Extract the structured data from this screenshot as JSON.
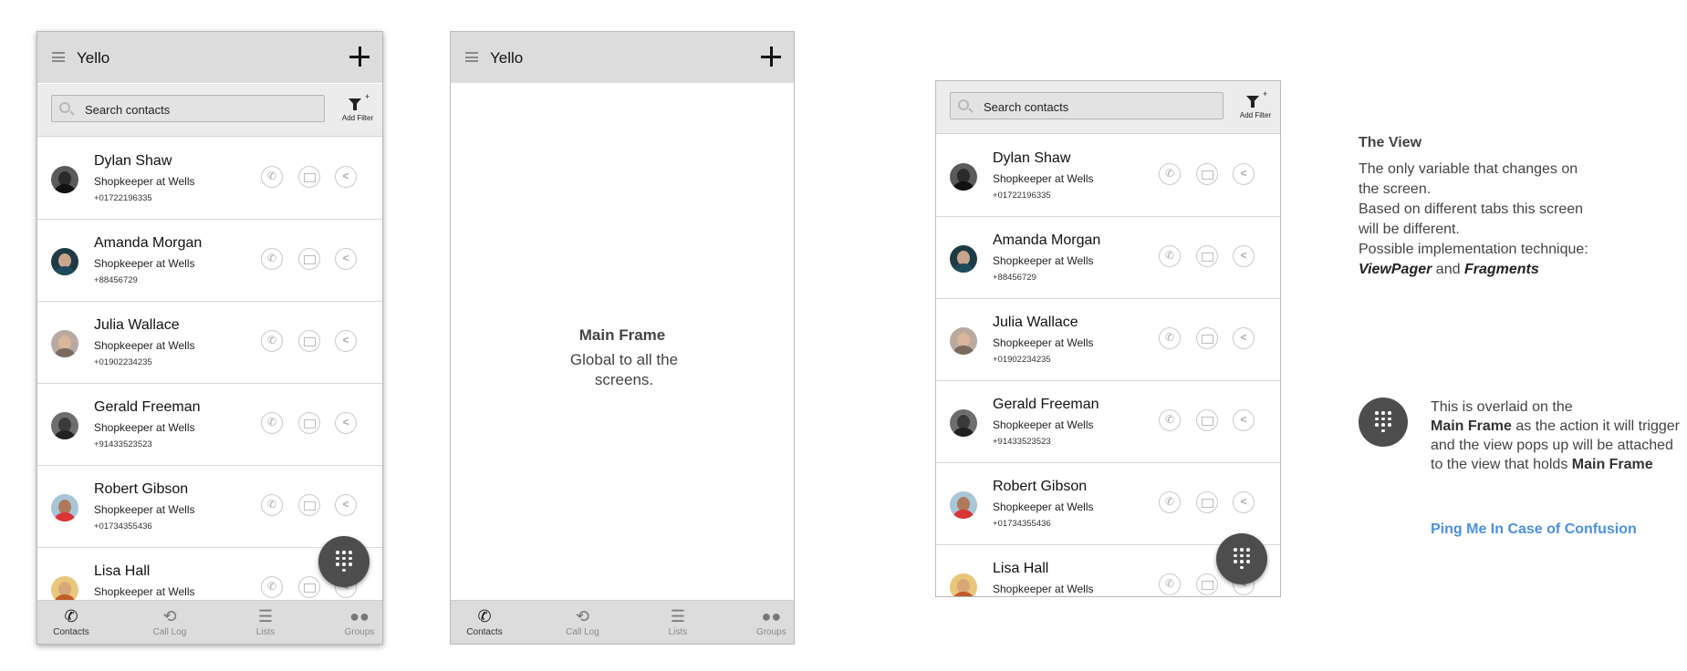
{
  "app": {
    "title": "Yello",
    "search_placeholder": "Search contacts",
    "add_filter_label": "Add Filter",
    "fab_icon": "dialpad-icon"
  },
  "contacts": [
    {
      "name": "Dylan Shaw",
      "title": "Shopkeeper at Wells",
      "phone": "+01722196335",
      "avatar_face": "#2a2a2a",
      "avatar_body": "#111111",
      "avatar_bg": "#5a5a5a"
    },
    {
      "name": "Amanda Morgan",
      "title": "Shopkeeper at Wells",
      "phone": "+88456729",
      "avatar_face": "#c9a58c",
      "avatar_body": "#1d4b5c",
      "avatar_bg": "#1e3a44"
    },
    {
      "name": "Julia Wallace",
      "title": "Shopkeeper at Wells",
      "phone": "+01902234235",
      "avatar_face": "#d9b69a",
      "avatar_body": "#7a6a5e",
      "avatar_bg": "#b8aaa0"
    },
    {
      "name": "Gerald Freeman",
      "title": "Shopkeeper at Wells",
      "phone": "+91433523523",
      "avatar_face": "#3a3a3a",
      "avatar_body": "#222222",
      "avatar_bg": "#6e6e6e"
    },
    {
      "name": "Robert Gibson",
      "title": "Shopkeeper at Wells",
      "phone": "+01734355436",
      "avatar_face": "#b07a5a",
      "avatar_body": "#d93535",
      "avatar_bg": "#a9c6d9"
    },
    {
      "name": "Lisa Hall",
      "title": "Shopkeeper at Wells",
      "phone": "",
      "avatar_face": "#d9a87a",
      "avatar_body": "#c25b2a",
      "avatar_bg": "#e8c77a"
    }
  ],
  "tabs": [
    {
      "label": "Contacts",
      "icon": "phone-icon",
      "active": true
    },
    {
      "label": "Call Log",
      "icon": "history-icon",
      "active": false
    },
    {
      "label": "Lists",
      "icon": "list-icon",
      "active": false
    },
    {
      "label": "Groups",
      "icon": "groups-icon",
      "active": false
    }
  ],
  "main_frame": {
    "title": "Main Frame",
    "subtitle": "Global to all the screens."
  },
  "notes": {
    "view_heading": "The View",
    "view_text_1": "The only variable that changes on the screen.",
    "view_text_2": "Based on different tabs this screen will be different.",
    "view_text_3": "Possible implementation technique:",
    "view_term_1": "ViewPager",
    "view_and": "and",
    "view_term_2": "Fragments",
    "overlay_1": "This is overlaid on the",
    "overlay_main_frame_1": "Main Frame",
    "overlay_2": "as the action it will trigger and the view pops up will be attached to the view that holds",
    "overlay_main_frame_2": "Main Frame",
    "ping_link": "Ping Me In Case of Confusion"
  },
  "colors": {
    "appbar": "#dcdcdc",
    "fab": "#4d4d4d",
    "link": "#4a90e2"
  }
}
